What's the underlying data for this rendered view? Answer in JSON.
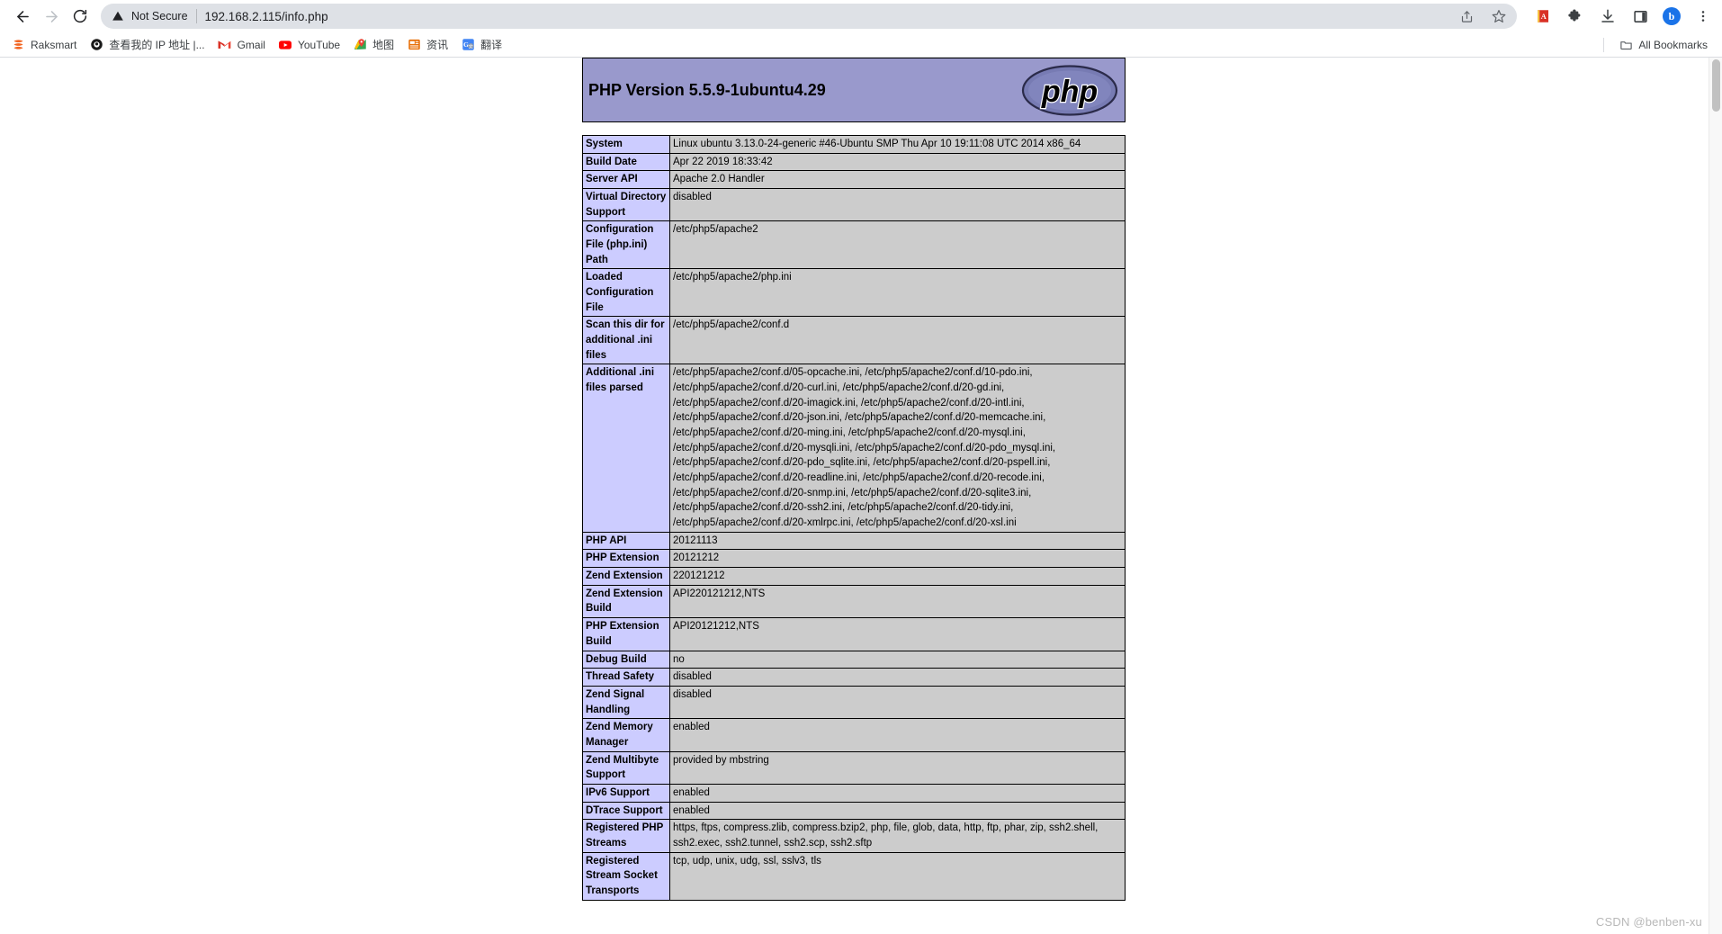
{
  "browser": {
    "nav": {
      "back_label": "Back",
      "forward_label": "Forward",
      "reload_label": "Reload"
    },
    "omnibox": {
      "security_text": "Not Secure",
      "url": "192.168.2.115/info.php",
      "share_label": "Share this page",
      "bookmark_label": "Bookmark this tab"
    },
    "actions": {
      "extension_red_label": "Red extension",
      "extensions_label": "Extensions",
      "downloads_label": "Downloads",
      "side_panel_label": "Side panel",
      "profile_initial": "b",
      "menu_label": "Customize and control Google Chrome"
    },
    "bookmarks": [
      {
        "label": "Raksmart",
        "icon": "raksmart-icon"
      },
      {
        "label": "查看我的 IP 地址 |...",
        "icon": "ip-lookup-icon"
      },
      {
        "label": "Gmail",
        "icon": "gmail-icon"
      },
      {
        "label": "YouTube",
        "icon": "youtube-icon"
      },
      {
        "label": "地图",
        "icon": "maps-icon"
      },
      {
        "label": "资讯",
        "icon": "news-icon"
      },
      {
        "label": "翻译",
        "icon": "translate-icon"
      }
    ],
    "all_bookmarks_label": "All Bookmarks"
  },
  "phpinfo": {
    "title": "PHP Version 5.5.9-1ubuntu4.29",
    "logo_text": "php",
    "rows": [
      {
        "key": "System",
        "lines": [
          "Linux ubuntu 3.13.0-24-generic #46-Ubuntu SMP Thu Apr 10 19:11:08 UTC 2014 x86_64"
        ]
      },
      {
        "key": "Build Date",
        "lines": [
          "Apr 22 2019 18:33:42"
        ]
      },
      {
        "key": "Server API",
        "lines": [
          "Apache 2.0 Handler"
        ]
      },
      {
        "key": "Virtual Directory Support",
        "lines": [
          "disabled"
        ]
      },
      {
        "key": "Configuration File (php.ini) Path",
        "lines": [
          "/etc/php5/apache2"
        ]
      },
      {
        "key": "Loaded Configuration File",
        "lines": [
          "/etc/php5/apache2/php.ini"
        ]
      },
      {
        "key": "Scan this dir for additional .ini files",
        "lines": [
          "/etc/php5/apache2/conf.d"
        ]
      },
      {
        "key": "Additional .ini files parsed",
        "lines": [
          "/etc/php5/apache2/conf.d/05-opcache.ini, /etc/php5/apache2/conf.d/10-pdo.ini,",
          "/etc/php5/apache2/conf.d/20-curl.ini, /etc/php5/apache2/conf.d/20-gd.ini,",
          "/etc/php5/apache2/conf.d/20-imagick.ini, /etc/php5/apache2/conf.d/20-intl.ini,",
          "/etc/php5/apache2/conf.d/20-json.ini, /etc/php5/apache2/conf.d/20-memcache.ini,",
          "/etc/php5/apache2/conf.d/20-ming.ini, /etc/php5/apache2/conf.d/20-mysql.ini,",
          "/etc/php5/apache2/conf.d/20-mysqli.ini, /etc/php5/apache2/conf.d/20-pdo_mysql.ini,",
          "/etc/php5/apache2/conf.d/20-pdo_sqlite.ini, /etc/php5/apache2/conf.d/20-pspell.ini,",
          "/etc/php5/apache2/conf.d/20-readline.ini, /etc/php5/apache2/conf.d/20-recode.ini,",
          "/etc/php5/apache2/conf.d/20-snmp.ini, /etc/php5/apache2/conf.d/20-sqlite3.ini,",
          "/etc/php5/apache2/conf.d/20-ssh2.ini, /etc/php5/apache2/conf.d/20-tidy.ini,",
          "/etc/php5/apache2/conf.d/20-xmlrpc.ini, /etc/php5/apache2/conf.d/20-xsl.ini"
        ]
      },
      {
        "key": "PHP API",
        "lines": [
          "20121113"
        ]
      },
      {
        "key": "PHP Extension",
        "lines": [
          "20121212"
        ]
      },
      {
        "key": "Zend Extension",
        "lines": [
          "220121212"
        ]
      },
      {
        "key": "Zend Extension Build",
        "lines": [
          "API220121212,NTS"
        ]
      },
      {
        "key": "PHP Extension Build",
        "lines": [
          "API20121212,NTS"
        ]
      },
      {
        "key": "Debug Build",
        "lines": [
          "no"
        ]
      },
      {
        "key": "Thread Safety",
        "lines": [
          "disabled"
        ]
      },
      {
        "key": "Zend Signal Handling",
        "lines": [
          "disabled"
        ]
      },
      {
        "key": "Zend Memory Manager",
        "lines": [
          "enabled"
        ]
      },
      {
        "key": "Zend Multibyte Support",
        "lines": [
          "provided by mbstring"
        ]
      },
      {
        "key": "IPv6 Support",
        "lines": [
          "enabled"
        ]
      },
      {
        "key": "DTrace Support",
        "lines": [
          "enabled"
        ]
      },
      {
        "key": "Registered PHP Streams",
        "lines": [
          "https, ftps, compress.zlib, compress.bzip2, php, file, glob, data, http, ftp, phar, zip, ssh2.shell,",
          "ssh2.exec, ssh2.tunnel, ssh2.scp, ssh2.sftp"
        ]
      },
      {
        "key": "Registered Stream Socket Transports",
        "lines": [
          "tcp, udp, unix, udg, ssl, sslv3, tls"
        ]
      }
    ],
    "colors": {
      "header_bg": "#9999cc",
      "key_bg": "#ccccff",
      "value_bg": "#cccccc",
      "border": "#000000"
    }
  },
  "watermark": "CSDN @benben-xu"
}
